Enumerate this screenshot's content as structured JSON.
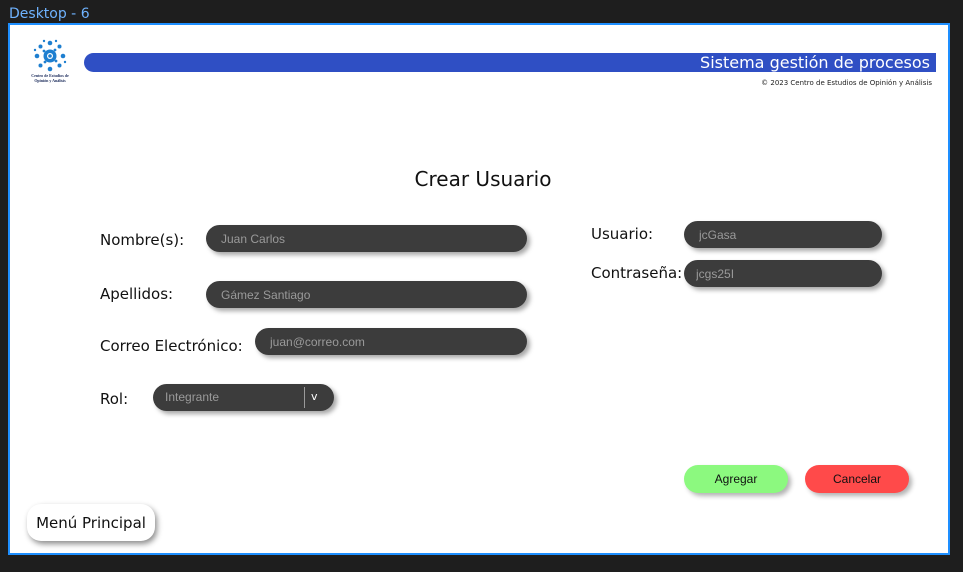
{
  "frame": {
    "label": "Desktop - 6"
  },
  "header": {
    "logo_text": "Centro de Estudios de Opinión y Análisis",
    "title": "Sistema gestión de procesos",
    "copyright": "© 2023 Centro de Estudios de Opinión y Análisis"
  },
  "form": {
    "title": "Crear Usuario",
    "nombre": {
      "label": "Nombre(s):",
      "placeholder": "Juan Carlos"
    },
    "apellidos": {
      "label": "Apellidos:",
      "placeholder": "Gámez Santiago"
    },
    "correo": {
      "label": "Correo Electrónico:",
      "placeholder": "juan@correo.com"
    },
    "rol": {
      "label": "Rol:",
      "value": "Integrante",
      "chevron": "v"
    },
    "usuario": {
      "label": "Usuario:",
      "placeholder": "jcGasa"
    },
    "contrasena": {
      "label": "Contraseña:",
      "placeholder": "jcgs25I"
    }
  },
  "actions": {
    "add_label": "Agregar",
    "cancel_label": "Cancelar",
    "menu_label": "Menú Principal"
  },
  "colors": {
    "header_bar": "#2f4fc4",
    "frame_border": "#1e8fff",
    "add_button": "#8cf97f",
    "cancel_button": "#ff4a4a",
    "input_bg": "#3c3c3c"
  }
}
